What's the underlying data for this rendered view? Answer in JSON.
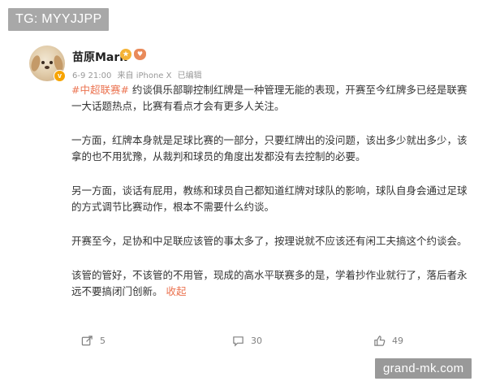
{
  "overlay": {
    "tg_label": "TG: MYYJJPP",
    "watermark": "grand-mk.com"
  },
  "post": {
    "author": "苗原Mark",
    "verified_symbol": "v",
    "level_icon": "icon-level-badge",
    "fan_icon": "icon-fan-badge",
    "date": "6-9 21:00",
    "source": "来自 iPhone X",
    "edited": "已编辑",
    "topic": "#中超联赛#",
    "paragraphs": [
      " 约谈俱乐部聊控制红牌是一种管理无能的表现，开赛至今红牌多已经是联赛一大话题热点，比赛有看点才会有更多人关注。",
      "一方面，红牌本身就是足球比赛的一部分，只要红牌出的没问题，该出多少就出多少，该拿的也不用犹豫，从裁判和球员的角度出发都没有去控制的必要。",
      "另一方面，谈话有屁用，教练和球员自己都知道红牌对球队的影响，球队自身会通过足球的方式调节比赛动作，根本不需要什么约谈。",
      "开赛至今，足协和中足联应该管的事太多了，按理说就不应该还有闲工夫搞这个约谈会。",
      "该管的管好，不该管的不用管，现成的高水平联赛多的是，学着抄作业就行了，落后者永远不要搞闭门创新。"
    ],
    "collapse_label": "收起"
  },
  "actions": {
    "repost": {
      "icon": "share-icon",
      "count": "5"
    },
    "comment": {
      "icon": "comment-icon",
      "count": "30"
    },
    "like": {
      "icon": "thumbs-up-icon",
      "count": "49"
    }
  },
  "colors": {
    "accent": "#eb7350",
    "meta": "#999999",
    "text": "#333333"
  }
}
